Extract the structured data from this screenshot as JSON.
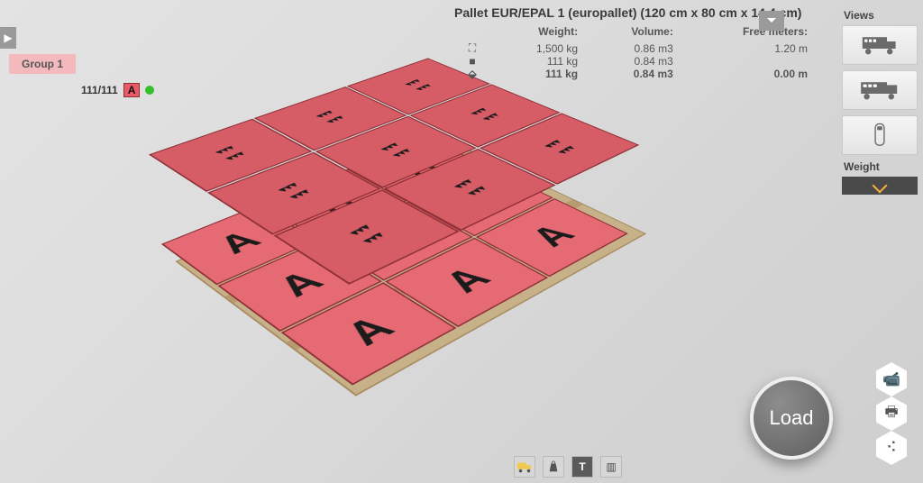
{
  "left": {
    "group_label": "Group 1",
    "count": "111/111",
    "box_badge": "A"
  },
  "info": {
    "title": "Pallet EUR/EPAL 1 (europallet) (120 cm x 80 cm x 14.4 cm)",
    "headers": {
      "weight": "Weight:",
      "volume": "Volume:",
      "free": "Free meters:"
    },
    "rows": [
      {
        "icon": "pallet-icon",
        "weight": "1,500 kg",
        "volume": "0.86 m3",
        "free": "1.20 m",
        "bold": false
      },
      {
        "icon": "box-icon",
        "weight": "111 kg",
        "volume": "0.84 m3",
        "free": "",
        "bold": false
      },
      {
        "icon": "cartload-icon",
        "weight": "111 kg",
        "volume": "0.84 m3",
        "free": "0.00 m",
        "bold": true
      }
    ]
  },
  "right": {
    "views_label": "Views",
    "weight_label": "Weight"
  },
  "actions": {
    "load_label": "Load"
  },
  "box_marker": "A",
  "colors": {
    "box": "#e66a73",
    "box_edge": "#8c2f36",
    "accent_green": "#32c02e"
  }
}
